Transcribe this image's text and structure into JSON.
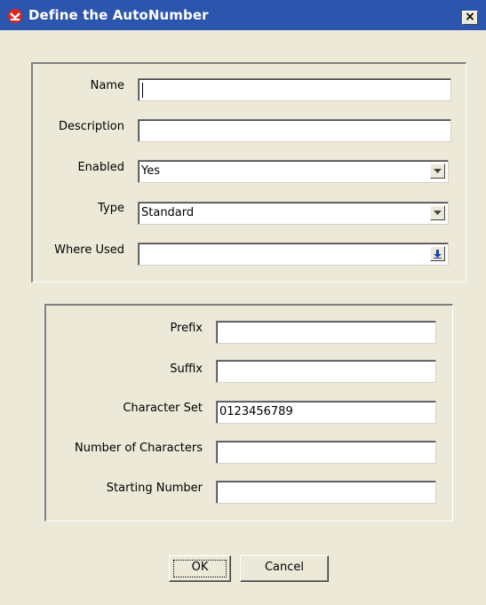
{
  "window": {
    "title": "Define the AutoNumber",
    "close_label": "×"
  },
  "colors": {
    "titlebar": "#2c55ad",
    "face": "#ece9d8",
    "app_icon": "#e2231a"
  },
  "group_general": {
    "name_label": "Name",
    "name_value": "",
    "description_label": "Description",
    "description_value": "",
    "enabled_label": "Enabled",
    "enabled_value": "Yes",
    "type_label": "Type",
    "type_value": "Standard",
    "where_used_label": "Where Used",
    "where_used_value": ""
  },
  "group_format": {
    "prefix_label": "Prefix",
    "prefix_value": "",
    "suffix_label": "Suffix",
    "suffix_value": "",
    "charset_label": "Character Set",
    "charset_value": "0123456789",
    "num_chars_label": "Number of Characters",
    "num_chars_value": "",
    "start_label": "Starting Number",
    "start_value": ""
  },
  "buttons": {
    "ok": "OK",
    "cancel": "Cancel"
  },
  "icons": {
    "app": "app-icon",
    "dropdown": "chevron-down-icon",
    "where_used": "arrow-down-icon",
    "close": "close-icon"
  }
}
